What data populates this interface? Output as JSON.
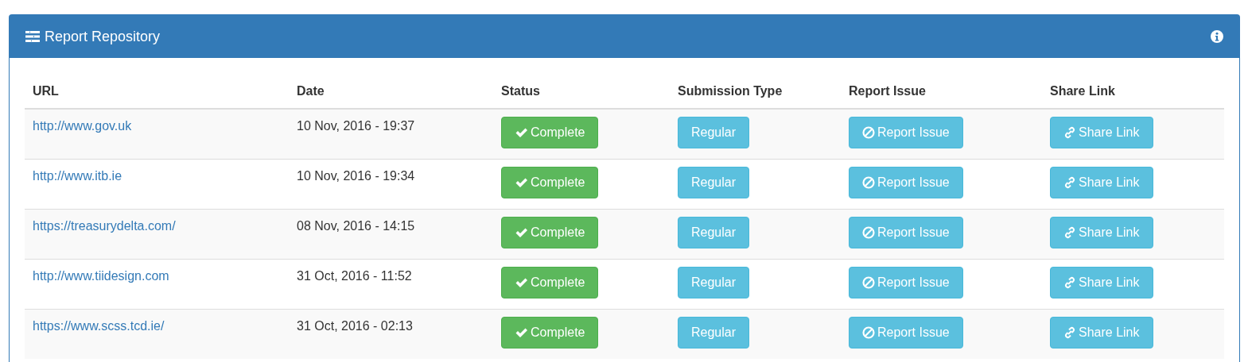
{
  "panel": {
    "title": "Report Repository"
  },
  "table": {
    "columns": [
      "URL",
      "Date",
      "Status",
      "Submission Type",
      "Report Issue",
      "Share Link"
    ],
    "rows": [
      {
        "url": "http://www.gov.uk",
        "date": "10 Nov, 2016 - 19:37",
        "status": {
          "label": "Complete",
          "kind": "success"
        },
        "submission_type": "Regular",
        "report_issue": "Report Issue",
        "share_link": "Share Link"
      },
      {
        "url": "http://www.itb.ie",
        "date": "10 Nov, 2016 - 19:34",
        "status": {
          "label": "Complete",
          "kind": "success"
        },
        "submission_type": "Regular",
        "report_issue": "Report Issue",
        "share_link": "Share Link"
      },
      {
        "url": "https://treasurydelta.com/",
        "date": "08 Nov, 2016 - 14:15",
        "status": {
          "label": "Complete",
          "kind": "success"
        },
        "submission_type": "Regular",
        "report_issue": "Report Issue",
        "share_link": "Share Link"
      },
      {
        "url": "http://www.tiidesign.com",
        "date": "31 Oct, 2016 - 11:52",
        "status": {
          "label": "Complete",
          "kind": "success"
        },
        "submission_type": "Regular",
        "report_issue": "Report Issue",
        "share_link": "Share Link"
      },
      {
        "url": "https://www.scss.tcd.ie/",
        "date": "31 Oct, 2016 - 02:13",
        "status": {
          "label": "Complete",
          "kind": "success"
        },
        "submission_type": "Regular",
        "report_issue": "Report Issue",
        "share_link": "Share Link"
      }
    ]
  }
}
